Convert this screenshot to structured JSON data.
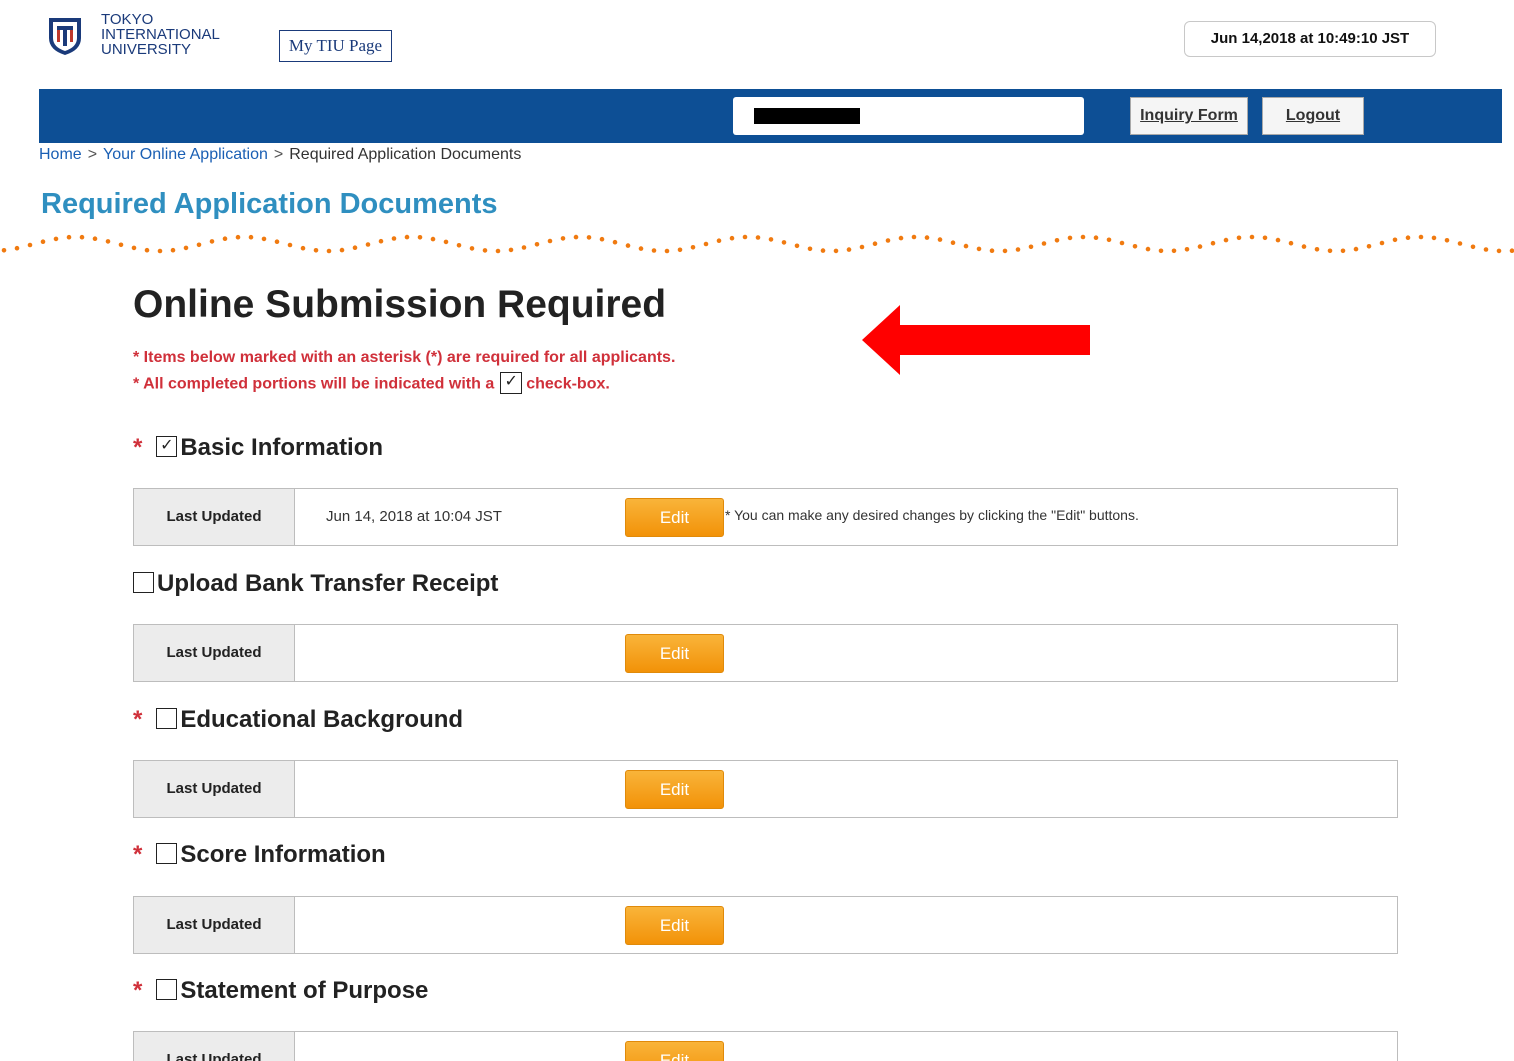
{
  "header": {
    "university_lines": [
      "TOKYO",
      "INTERNATIONAL",
      "UNIVERSITY"
    ],
    "my_page_label": "My TIU Page",
    "datetime": "Jun 14,2018 at 10:49:10 JST",
    "inquiry_label": "Inquiry Form",
    "logout_label": "Logout"
  },
  "breadcrumb": {
    "home": "Home",
    "sep1": ">",
    "app": "Your Online Application",
    "sep2": ">",
    "current": "Required Application Documents"
  },
  "page_title": "Required Application Documents",
  "main_heading": "Online Submission Required",
  "notes": {
    "note1": "* Items below marked with an asterisk (*) are required for all applicants.",
    "note2_prefix": "* All completed portions will be indicated with a",
    "note2_check": "✓",
    "note2_suffix": "check-box."
  },
  "sections": [
    {
      "asterisk": "*",
      "check": "✓",
      "title": "Basic Information",
      "label": "Last Updated",
      "value": "Jun 14, 2018 at 10:04 JST",
      "edit": "Edit",
      "hint": "* You can make any desired changes by clicking the \"Edit\" buttons."
    },
    {
      "asterisk": "",
      "check": "",
      "title": "Upload Bank Transfer Receipt",
      "label": "Last Updated",
      "value": "",
      "edit": "Edit",
      "hint": ""
    },
    {
      "asterisk": "*",
      "check": "",
      "title": "Educational Background",
      "label": "Last Updated",
      "value": "",
      "edit": "Edit",
      "hint": ""
    },
    {
      "asterisk": "*",
      "check": "",
      "title": "Score Information",
      "label": "Last Updated",
      "value": "",
      "edit": "Edit",
      "hint": ""
    },
    {
      "asterisk": "*",
      "check": "",
      "title": "Statement of Purpose",
      "label": "Last Updated",
      "value": "",
      "edit": "Edit",
      "hint": ""
    }
  ],
  "colors": {
    "navbar": "#0d4f95",
    "title_blue": "#2f8fc0",
    "note_red": "#d0303a",
    "edit_orange": "#f29208",
    "wave_orange": "#f07a10",
    "arrow_red": "#ff0000"
  }
}
